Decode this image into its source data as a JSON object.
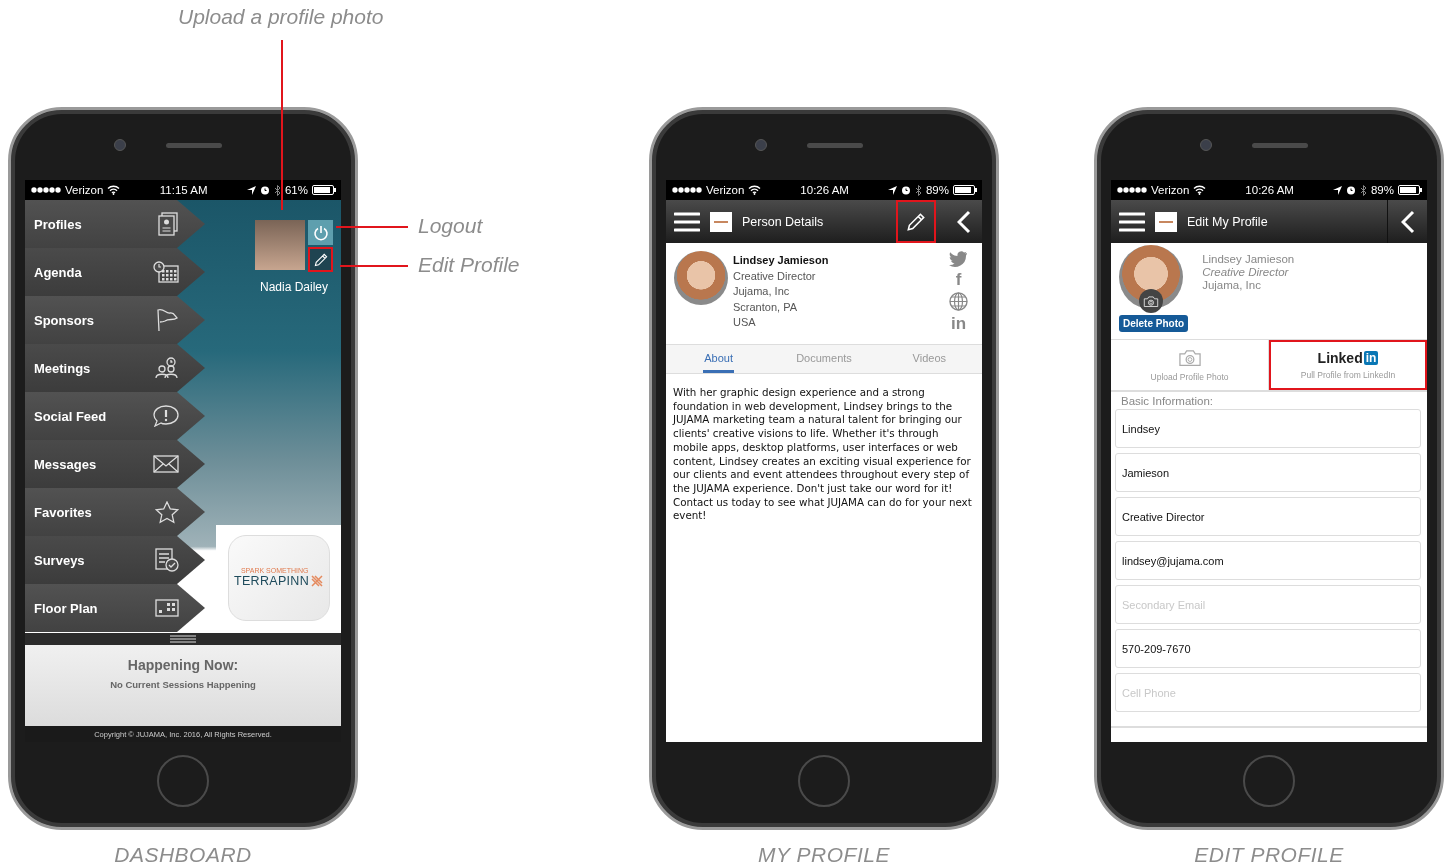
{
  "annotations": [
    {
      "text": "Upload a profile photo"
    },
    {
      "text": "Logout"
    },
    {
      "text": "Edit Profile"
    }
  ],
  "phones": [
    {
      "kind": "dashboard",
      "caption": "DASHBOARD",
      "status_bar": {
        "carrier": "Verizon",
        "time": "11:15 AM",
        "battery": "61%"
      },
      "menu": [
        {
          "label": "Profiles"
        },
        {
          "label": "Agenda"
        },
        {
          "label": "Sponsors"
        },
        {
          "label": "Meetings"
        },
        {
          "label": "Social Feed"
        },
        {
          "label": "Messages"
        },
        {
          "label": "Favorites"
        },
        {
          "label": "Surveys"
        },
        {
          "label": "Floor Plan"
        }
      ],
      "user": {
        "name": "Nadia Dailey",
        "edit_annotated": true
      },
      "logo": {
        "tagline": "SPARK SOMETHING",
        "name": "TERRAPINN"
      },
      "happening": {
        "title": "Happening Now:",
        "subtitle": "No Current Sessions Happening"
      },
      "copyright": "Copyright © JUJAMA, Inc. 2016, All Rights Reserved."
    },
    {
      "kind": "person",
      "caption": "MY PROFILE",
      "status_bar": {
        "carrier": "Verizon",
        "time": "10:26 AM",
        "battery": "89%"
      },
      "nav": {
        "title": "Person Details",
        "edit_annotated": true
      },
      "person": {
        "name": "Lindsey Jamieson",
        "lines": [
          "Creative Director",
          "Jujama, Inc",
          "Scranton, PA",
          "USA"
        ]
      },
      "social": [
        {
          "kind": "bird"
        },
        {
          "kind": "letter",
          "label": "f"
        },
        {
          "kind": "globe"
        },
        {
          "kind": "letter",
          "label": "in"
        }
      ],
      "tabs": [
        {
          "label": "About",
          "selected": true
        },
        {
          "label": "Documents",
          "selected": false
        },
        {
          "label": "Videos",
          "selected": false
        }
      ],
      "bio": "With her graphic design experience and a strong foundation in web development, Lindsey brings to the JUJAMA marketing team a natural talent for bringing our clients' creative visions to life. Whether it's through mobile apps, desktop platforms, user interfaces or web content, Lindsey creates an exciting visual experience for our clients and event attendees throughout every step of the JUJAMA experience. Don't just take our word for it! Contact us today to see what JUJAMA can do for your next event!"
    },
    {
      "kind": "edit",
      "caption": "EDIT PROFILE",
      "status_bar": {
        "carrier": "Verizon",
        "time": "10:26 AM",
        "battery": "89%"
      },
      "nav": {
        "title": "Edit My Profile"
      },
      "person": {
        "name": "Lindsey Jamieson",
        "title": "Creative Director",
        "company": "Jujama, Inc"
      },
      "delete_button": "Delete Photo",
      "actions": [
        {
          "kind": "upload",
          "label": "Upload Profile Photo",
          "annotated": false
        },
        {
          "kind": "linkedin",
          "logo_text": "Linked",
          "logo_badge": "in",
          "label": "Pull Profile from LinkedIn",
          "annotated": true
        }
      ],
      "section_label": "Basic Information:",
      "fields": [
        {
          "value": "Lindsey"
        },
        {
          "value": "Jamieson"
        },
        {
          "value": "Creative Director"
        },
        {
          "value": "lindsey@jujama.com"
        },
        {
          "placeholder": "Secondary Email"
        },
        {
          "value": "570-209-7670"
        },
        {
          "placeholder": "Cell Phone"
        }
      ]
    }
  ]
}
